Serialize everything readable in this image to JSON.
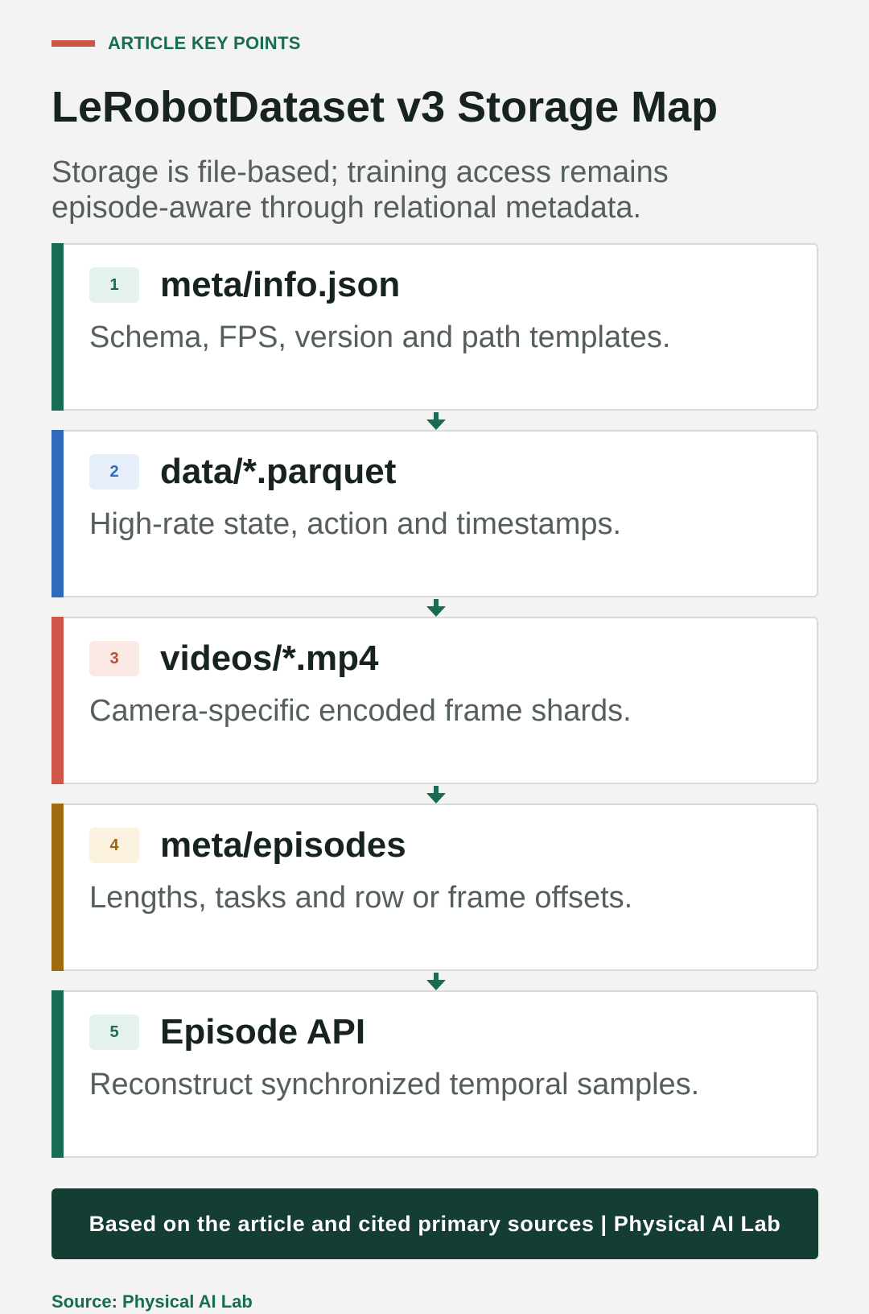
{
  "kicker": "ARTICLE KEY POINTS",
  "title": "LeRobotDataset v3 Storage Map",
  "subtitle": "Storage is file-based; training access remains episode-aware through relational metadata.",
  "colors": {
    "kicker_bar": "#c95748",
    "kicker_text": "#186b55",
    "arrow": "#186b55",
    "footer_bg": "#143d33",
    "page_bg": "#f3f4f2"
  },
  "steps": [
    {
      "number": "1",
      "title": "meta/info.json",
      "description": "Schema, FPS, version and path templates.",
      "accent": "#186b55",
      "badge_bg": "#e4f1ec",
      "badge_text": "#186b55"
    },
    {
      "number": "2",
      "title": "data/*.parquet",
      "description": "High-rate state, action and timestamps.",
      "accent": "#2f6bba",
      "badge_bg": "#e6eff9",
      "badge_text": "#2f6bba"
    },
    {
      "number": "3",
      "title": "videos/*.mp4",
      "description": "Camera-specific encoded frame shards.",
      "accent": "#d0554a",
      "badge_bg": "#fbe9e6",
      "badge_text": "#c24a3e"
    },
    {
      "number": "4",
      "title": "meta/episodes",
      "description": "Lengths, tasks and row or frame offsets.",
      "accent": "#a06b10",
      "badge_bg": "#fbf1df",
      "badge_text": "#9a6710"
    },
    {
      "number": "5",
      "title": "Episode API",
      "description": "Reconstruct synchronized temporal samples.",
      "accent": "#186b55",
      "badge_bg": "#e4f1ec",
      "badge_text": "#186b55"
    }
  ],
  "footer": "Based on the article and cited primary sources | Physical AI Lab",
  "source": "Source: Physical AI Lab"
}
